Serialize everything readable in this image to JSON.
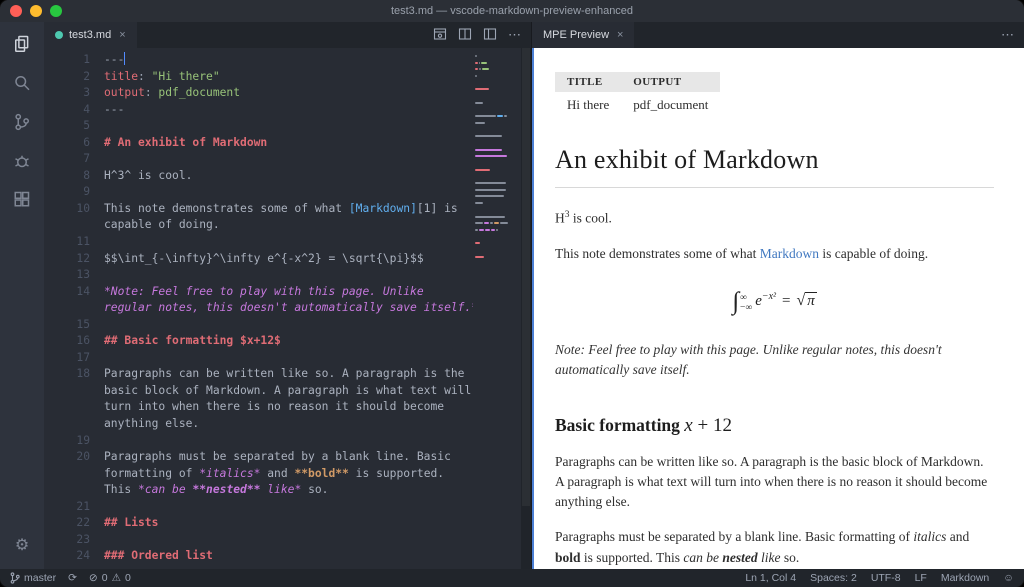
{
  "window": {
    "title": "test3.md — vscode-markdown-preview-enhanced"
  },
  "icons": {
    "more": "⋯",
    "close": "×",
    "gear": "⚙",
    "sync": "⟳",
    "error": "⊘",
    "warning": "⚠",
    "smiley": "☺"
  },
  "activity_bar": {
    "items": [
      "explorer",
      "search",
      "source-control",
      "debug",
      "extensions"
    ]
  },
  "editor": {
    "tab": {
      "label": "test3.md"
    },
    "minimap_colors": {
      "punc": "#7b818d",
      "key": "#e06c75",
      "str": "#98c379",
      "head": "#e06c75",
      "text": "#848b98",
      "link": "#61afef",
      "ital": "#c678dd",
      "bold": "#d19a66",
      "boldital": "#c678dd"
    },
    "rows": [
      {
        "n": "1",
        "cursor": true,
        "s": [
          {
            "c": "punc",
            "t": "---"
          }
        ]
      },
      {
        "n": "2",
        "s": [
          {
            "c": "key",
            "t": "title"
          },
          {
            "c": "punc",
            "t": ": "
          },
          {
            "c": "str",
            "t": "\"Hi there\""
          }
        ]
      },
      {
        "n": "3",
        "s": [
          {
            "c": "key",
            "t": "output"
          },
          {
            "c": "punc",
            "t": ": "
          },
          {
            "c": "str",
            "t": "pdf_document"
          }
        ]
      },
      {
        "n": "4",
        "s": [
          {
            "c": "punc",
            "t": "---"
          }
        ]
      },
      {
        "n": "5",
        "s": []
      },
      {
        "n": "6",
        "s": [
          {
            "c": "head",
            "t": "# An exhibit of Markdown"
          }
        ]
      },
      {
        "n": "7",
        "s": []
      },
      {
        "n": "8",
        "s": [
          {
            "c": "text",
            "t": "H^3^ is cool."
          }
        ]
      },
      {
        "n": "9",
        "s": []
      },
      {
        "n": "10",
        "s": [
          {
            "c": "text",
            "t": "This note demonstrates some of what "
          },
          {
            "c": "link",
            "t": "[Markdown]"
          },
          {
            "c": "text",
            "t": "[1] is"
          }
        ]
      },
      {
        "n": "",
        "s": [
          {
            "c": "text",
            "t": "capable of doing."
          }
        ]
      },
      {
        "n": "11",
        "s": []
      },
      {
        "n": "12",
        "s": [
          {
            "c": "text",
            "t": "$$\\int_{-\\infty}^\\infty e^{-x^2} = \\sqrt{\\pi}$$"
          }
        ]
      },
      {
        "n": "13",
        "s": []
      },
      {
        "n": "14",
        "s": [
          {
            "c": "ital",
            "t": "*Note: Feel free to play with this page. Unlike"
          }
        ]
      },
      {
        "n": "",
        "s": [
          {
            "c": "ital",
            "t": "regular notes, this doesn't automatically save itself.*"
          }
        ]
      },
      {
        "n": "15",
        "s": []
      },
      {
        "n": "16",
        "s": [
          {
            "c": "head",
            "t": "## Basic formatting $x+12$"
          }
        ]
      },
      {
        "n": "17",
        "s": []
      },
      {
        "n": "18",
        "s": [
          {
            "c": "text",
            "t": "Paragraphs can be written like so. A paragraph is the"
          }
        ]
      },
      {
        "n": "",
        "s": [
          {
            "c": "text",
            "t": "basic block of Markdown. A paragraph is what text will"
          }
        ]
      },
      {
        "n": "",
        "s": [
          {
            "c": "text",
            "t": "turn into when there is no reason it should become"
          }
        ]
      },
      {
        "n": "",
        "s": [
          {
            "c": "text",
            "t": "anything else."
          }
        ]
      },
      {
        "n": "19",
        "s": []
      },
      {
        "n": "20",
        "s": [
          {
            "c": "text",
            "t": "Paragraphs must be separated by a blank line. Basic"
          }
        ]
      },
      {
        "n": "",
        "s": [
          {
            "c": "text",
            "t": "formatting of "
          },
          {
            "c": "ital",
            "t": "*italics*"
          },
          {
            "c": "text",
            "t": " and "
          },
          {
            "c": "bold",
            "t": "**bold**"
          },
          {
            "c": "text",
            "t": " is supported."
          }
        ]
      },
      {
        "n": "",
        "s": [
          {
            "c": "text",
            "t": "This "
          },
          {
            "c": "ital",
            "t": "*can be "
          },
          {
            "c": "boldital",
            "t": "**nested**"
          },
          {
            "c": "ital",
            "t": " like*"
          },
          {
            "c": "text",
            "t": " so."
          }
        ]
      },
      {
        "n": "21",
        "s": []
      },
      {
        "n": "22",
        "s": [
          {
            "c": "head",
            "t": "## Lists"
          }
        ]
      },
      {
        "n": "23",
        "s": []
      },
      {
        "n": "24",
        "s": [
          {
            "c": "head",
            "t": "### Ordered list"
          }
        ]
      }
    ]
  },
  "preview": {
    "tab_label": "MPE Preview",
    "table": {
      "h1": "TITLE",
      "h2": "OUTPUT",
      "c1": "Hi there",
      "c2": "pdf_document"
    },
    "h1": "An exhibit of Markdown",
    "p_cool": {
      "a": "H",
      "sup": "3",
      "b": " is cool."
    },
    "p_demo": {
      "a": "This note demonstrates some of what ",
      "link": "Markdown",
      "b": " is capable of doing."
    },
    "math": {
      "integral": "∫",
      "upper": "∞",
      "lower": "−∞",
      "base": "e",
      "exponent": "−x²",
      "equals": "=",
      "radical": "√",
      "radicand": "π"
    },
    "note": "Note: Feel free to play with this page. Unlike regular notes, this doesn't automatically save itself.",
    "h2": {
      "a": "Basic formatting ",
      "math_var": "x",
      "math_rest": " + 12"
    },
    "p_para1": "Paragraphs can be written like so. A paragraph is the basic block of Markdown. A paragraph is what text will turn into when there is no reason it should become anything else.",
    "p_para2": {
      "a": "Paragraphs must be separated by a blank line. Basic formatting of ",
      "i": "italics",
      "b": " and ",
      "bold": "bold",
      "c": " is supported. This ",
      "i2": "can be ",
      "bi": "nested",
      "i3": " like",
      "d": " so."
    }
  },
  "status_bar": {
    "branch": "master",
    "errors": "0",
    "warnings": "0",
    "cursor": "Ln 1, Col 4",
    "spaces": "Spaces: 2",
    "encoding": "UTF-8",
    "eol": "LF",
    "language": "Markdown"
  }
}
